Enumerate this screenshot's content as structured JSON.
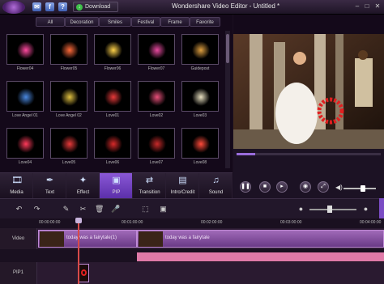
{
  "titlebar": {
    "download_label": "Download",
    "app_title": "Wondershare Video Editor - Untitled *",
    "icons": [
      "envelope-icon",
      "facebook-icon",
      "help-icon"
    ],
    "window_controls": [
      "–",
      "□",
      "✕"
    ]
  },
  "library": {
    "tabs": [
      {
        "label": "All",
        "active": true
      },
      {
        "label": "Decoration",
        "active": false
      },
      {
        "label": "Smiles",
        "active": false
      },
      {
        "label": "Festival",
        "active": false
      },
      {
        "label": "Frame",
        "active": false
      },
      {
        "label": "Favorite",
        "active": false
      }
    ],
    "items": [
      {
        "label": "Flower04",
        "color": "#ff4aa0"
      },
      {
        "label": "Flower05",
        "color": "#ff6a3a"
      },
      {
        "label": "Flower06",
        "color": "#ffd24a"
      },
      {
        "label": "Flower07",
        "color": "#e84aa0"
      },
      {
        "label": "Guidepost",
        "color": "#e0a040"
      },
      {
        "label": "Love Angel 01",
        "color": "#4a88e0"
      },
      {
        "label": "Love Angel 02",
        "color": "#e0c040"
      },
      {
        "label": "Love01",
        "color": "#e83a3a"
      },
      {
        "label": "Love02",
        "color": "#e8507a"
      },
      {
        "label": "Love03",
        "color": "#e8e0c0"
      },
      {
        "label": "Love04",
        "color": "#ff3a5a"
      },
      {
        "label": "Love05",
        "color": "#e83a3a"
      },
      {
        "label": "Love06",
        "color": "#d82a2a"
      },
      {
        "label": "Love07",
        "color": "#c82a2a"
      },
      {
        "label": "Love08",
        "color": "#ff4a3a"
      }
    ]
  },
  "tools": [
    {
      "label": "Media",
      "icon": "media-icon",
      "active": false
    },
    {
      "label": "Text",
      "icon": "text-icon",
      "active": false
    },
    {
      "label": "Effect",
      "icon": "effect-icon",
      "active": false
    },
    {
      "label": "PIP",
      "icon": "pip-icon",
      "active": true
    },
    {
      "label": "Transition",
      "icon": "transition-icon",
      "active": false
    },
    {
      "label": "Intro/Credit",
      "icon": "intro-credit-icon",
      "active": false
    },
    {
      "label": "Sound",
      "icon": "sound-icon",
      "active": false
    }
  ],
  "player": {
    "progress": 0.13,
    "volume": 0.6
  },
  "timeline": {
    "ruler": [
      "00:00:00:00",
      "00:01:00:00",
      "00:02:00:00",
      "00:03:00:00",
      "00:04:00:00"
    ],
    "tracks": {
      "video_label": "Video",
      "pip_label": "PIP1"
    },
    "clips": [
      {
        "text": "today was a fairytale(1)"
      },
      {
        "text": "today was a fairytale"
      }
    ]
  }
}
